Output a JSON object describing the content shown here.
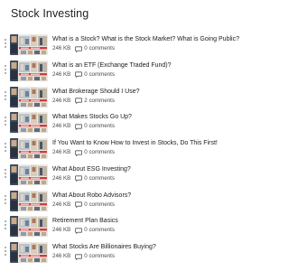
{
  "page": {
    "title": "Stock Investing"
  },
  "icons": {
    "drag": "drag-handle-icon",
    "comment": "comment-icon"
  },
  "items": [
    {
      "title": "What is a Stock? What is the Stock Market? What is Going Public?",
      "size": "246 KB",
      "comments": "0 comments"
    },
    {
      "title": "What is an ETF (Exchange Traded Fund)?",
      "size": "246 KB",
      "comments": "0 comments"
    },
    {
      "title": "What Brokerage Should I Use?",
      "size": "246 KB",
      "comments": "2 comments"
    },
    {
      "title": "What Makes Stocks Go Up?",
      "size": "246 KB",
      "comments": "0 comments"
    },
    {
      "title": "If You Want to Know How to Invest in Stocks, Do This First!",
      "size": "246 KB",
      "comments": "0 comments"
    },
    {
      "title": "What About ESG Investing?",
      "size": "246 KB",
      "comments": "0 comments"
    },
    {
      "title": "What About Robo Advisors?",
      "size": "246 KB",
      "comments": "0 comments"
    },
    {
      "title": "Retirement Plan Basics",
      "size": "246 KB",
      "comments": "0 comments"
    },
    {
      "title": "What Stocks Are Billionaires Buying?",
      "size": "246 KB",
      "comments": "0 comments"
    }
  ]
}
